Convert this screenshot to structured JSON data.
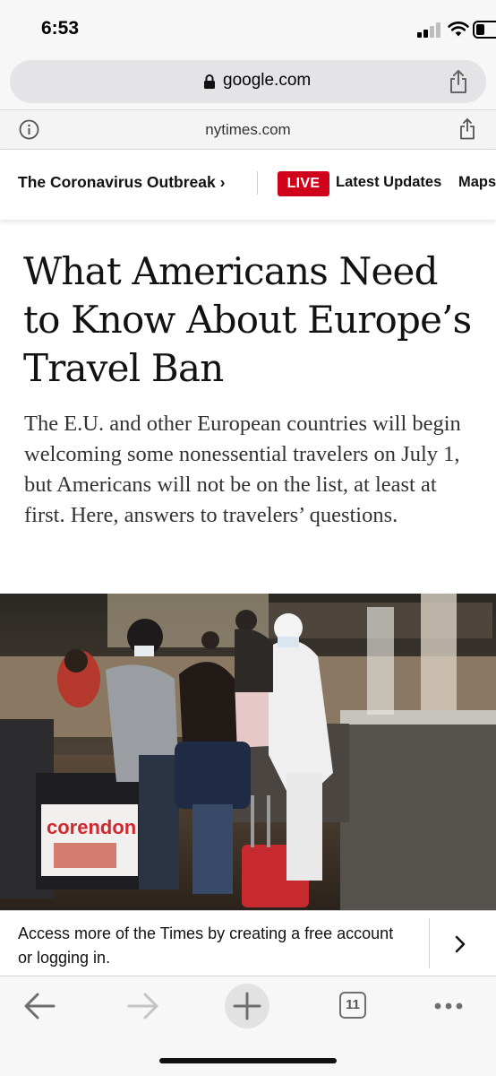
{
  "status_bar": {
    "time": "6:53",
    "icons": [
      "cellular-signal-icon",
      "wifi-icon",
      "battery-icon"
    ]
  },
  "browser": {
    "url": "google.com",
    "lock_icon": "lock-icon",
    "share_icon": "share-icon"
  },
  "amp_header": {
    "domain": "nytimes.com",
    "info_icon": "info-icon",
    "share_icon": "share-icon"
  },
  "section_nav": {
    "section_link": "The Coronavirus Outbreak ›",
    "live_badge": "LIVE",
    "latest_updates": "Latest Updates",
    "maps": "Maps",
    "live_color": "#d0021b"
  },
  "article": {
    "headline": "What Americans Need to Know About Europe’s Travel Ban",
    "summary": "The E.U. and other European countries will begin welcoming some nonessential travelers on July 1, but Americans will not be on the list, at least at first. Here, answers to travelers’ questions.",
    "photo_sign_text": "corendon"
  },
  "account_banner": {
    "text": "Access more of the Times by creating a free account or logging in.",
    "chevron_icon": "chevron-right-icon"
  },
  "toolbar": {
    "back_icon": "arrow-left-icon",
    "forward_icon": "arrow-right-icon",
    "new_tab_icon": "plus-icon",
    "tab_count": "11",
    "more_icon": "more-dots-icon"
  }
}
